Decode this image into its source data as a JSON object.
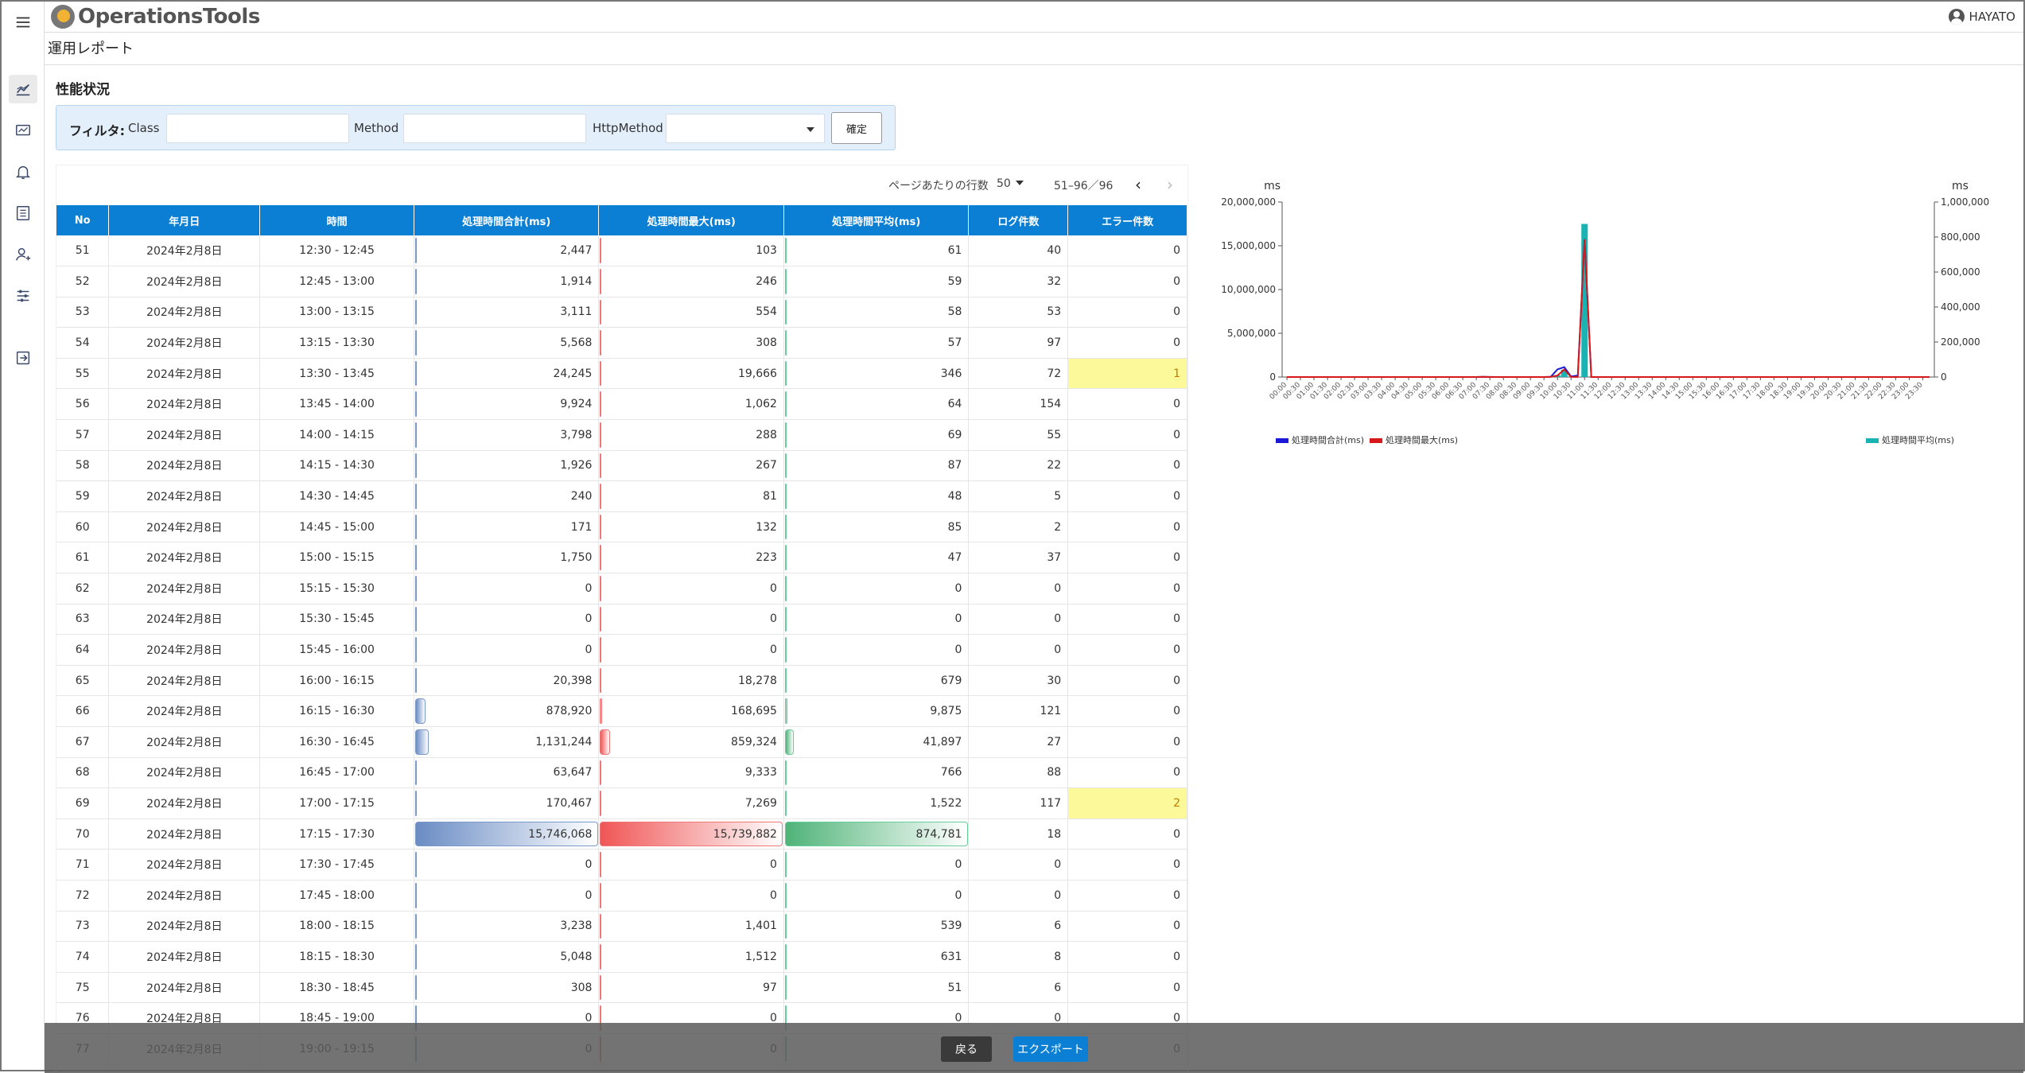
{
  "app": {
    "logo_text": "OperationsTools",
    "user_name": "HAYATO"
  },
  "page": {
    "title": "運用レポート",
    "section_title": "性能状況"
  },
  "filter": {
    "label": "フィルタ:",
    "class_label": "Class",
    "class_value": "",
    "method_label": "Method",
    "method_value": "",
    "httpmethod_label": "HttpMethod",
    "httpmethod_value": "",
    "confirm_label": "確定"
  },
  "pager": {
    "rows_label": "ページあたりの行数",
    "rows_value": "50",
    "range": "51–96／96"
  },
  "table": {
    "headers": [
      "No",
      "年月日",
      "時間",
      "処理時間合計(ms)",
      "処理時間最大(ms)",
      "処理時間平均(ms)",
      "ログ件数",
      "エラー件数"
    ],
    "bar_maxima": {
      "total": 15746068,
      "max": 15739882,
      "avg": 874781
    },
    "rows": [
      {
        "no": "51",
        "date": "2024年2月8日",
        "time": "12:30 - 12:45",
        "total": "2,447",
        "max": "103",
        "avg": "61",
        "logs": "40",
        "errors": "0"
      },
      {
        "no": "52",
        "date": "2024年2月8日",
        "time": "12:45 - 13:00",
        "total": "1,914",
        "max": "246",
        "avg": "59",
        "logs": "32",
        "errors": "0"
      },
      {
        "no": "53",
        "date": "2024年2月8日",
        "time": "13:00 - 13:15",
        "total": "3,111",
        "max": "554",
        "avg": "58",
        "logs": "53",
        "errors": "0"
      },
      {
        "no": "54",
        "date": "2024年2月8日",
        "time": "13:15 - 13:30",
        "total": "5,568",
        "max": "308",
        "avg": "57",
        "logs": "97",
        "errors": "0"
      },
      {
        "no": "55",
        "date": "2024年2月8日",
        "time": "13:30 - 13:45",
        "total": "24,245",
        "max": "19,666",
        "avg": "346",
        "logs": "72",
        "errors": "1"
      },
      {
        "no": "56",
        "date": "2024年2月8日",
        "time": "13:45 - 14:00",
        "total": "9,924",
        "max": "1,062",
        "avg": "64",
        "logs": "154",
        "errors": "0"
      },
      {
        "no": "57",
        "date": "2024年2月8日",
        "time": "14:00 - 14:15",
        "total": "3,798",
        "max": "288",
        "avg": "69",
        "logs": "55",
        "errors": "0"
      },
      {
        "no": "58",
        "date": "2024年2月8日",
        "time": "14:15 - 14:30",
        "total": "1,926",
        "max": "267",
        "avg": "87",
        "logs": "22",
        "errors": "0"
      },
      {
        "no": "59",
        "date": "2024年2月8日",
        "time": "14:30 - 14:45",
        "total": "240",
        "max": "81",
        "avg": "48",
        "logs": "5",
        "errors": "0"
      },
      {
        "no": "60",
        "date": "2024年2月8日",
        "time": "14:45 - 15:00",
        "total": "171",
        "max": "132",
        "avg": "85",
        "logs": "2",
        "errors": "0"
      },
      {
        "no": "61",
        "date": "2024年2月8日",
        "time": "15:00 - 15:15",
        "total": "1,750",
        "max": "223",
        "avg": "47",
        "logs": "37",
        "errors": "0"
      },
      {
        "no": "62",
        "date": "2024年2月8日",
        "time": "15:15 - 15:30",
        "total": "0",
        "max": "0",
        "avg": "0",
        "logs": "0",
        "errors": "0"
      },
      {
        "no": "63",
        "date": "2024年2月8日",
        "time": "15:30 - 15:45",
        "total": "0",
        "max": "0",
        "avg": "0",
        "logs": "0",
        "errors": "0"
      },
      {
        "no": "64",
        "date": "2024年2月8日",
        "time": "15:45 - 16:00",
        "total": "0",
        "max": "0",
        "avg": "0",
        "logs": "0",
        "errors": "0"
      },
      {
        "no": "65",
        "date": "2024年2月8日",
        "time": "16:00 - 16:15",
        "total": "20,398",
        "max": "18,278",
        "avg": "679",
        "logs": "30",
        "errors": "0"
      },
      {
        "no": "66",
        "date": "2024年2月8日",
        "time": "16:15 - 16:30",
        "total": "878,920",
        "max": "168,695",
        "avg": "9,875",
        "logs": "121",
        "errors": "0"
      },
      {
        "no": "67",
        "date": "2024年2月8日",
        "time": "16:30 - 16:45",
        "total": "1,131,244",
        "max": "859,324",
        "avg": "41,897",
        "logs": "27",
        "errors": "0"
      },
      {
        "no": "68",
        "date": "2024年2月8日",
        "time": "16:45 - 17:00",
        "total": "63,647",
        "max": "9,333",
        "avg": "766",
        "logs": "88",
        "errors": "0"
      },
      {
        "no": "69",
        "date": "2024年2月8日",
        "time": "17:00 - 17:15",
        "total": "170,467",
        "max": "7,269",
        "avg": "1,522",
        "logs": "117",
        "errors": "2"
      },
      {
        "no": "70",
        "date": "2024年2月8日",
        "time": "17:15 - 17:30",
        "total": "15,746,068",
        "max": "15,739,882",
        "avg": "874,781",
        "logs": "18",
        "errors": "0"
      },
      {
        "no": "71",
        "date": "2024年2月8日",
        "time": "17:30 - 17:45",
        "total": "0",
        "max": "0",
        "avg": "0",
        "logs": "0",
        "errors": "0"
      },
      {
        "no": "72",
        "date": "2024年2月8日",
        "time": "17:45 - 18:00",
        "total": "0",
        "max": "0",
        "avg": "0",
        "logs": "0",
        "errors": "0"
      },
      {
        "no": "73",
        "date": "2024年2月8日",
        "time": "18:00 - 18:15",
        "total": "3,238",
        "max": "1,401",
        "avg": "539",
        "logs": "6",
        "errors": "0"
      },
      {
        "no": "74",
        "date": "2024年2月8日",
        "time": "18:15 - 18:30",
        "total": "5,048",
        "max": "1,512",
        "avg": "631",
        "logs": "8",
        "errors": "0"
      },
      {
        "no": "75",
        "date": "2024年2月8日",
        "time": "18:30 - 18:45",
        "total": "308",
        "max": "97",
        "avg": "51",
        "logs": "6",
        "errors": "0"
      },
      {
        "no": "76",
        "date": "2024年2月8日",
        "time": "18:45 - 19:00",
        "total": "0",
        "max": "0",
        "avg": "0",
        "logs": "0",
        "errors": "0"
      },
      {
        "no": "77",
        "date": "2024年2月8日",
        "time": "19:00 - 19:15",
        "total": "0",
        "max": "0",
        "avg": "0",
        "logs": "0",
        "errors": "0"
      }
    ]
  },
  "chart_data": {
    "type": "line",
    "left_unit": "ms",
    "right_unit": "ms",
    "left_ticks": [
      "0",
      "5,000,000",
      "10,000,000",
      "15,000,000",
      "20,000,000"
    ],
    "right_ticks": [
      "0",
      "200,000",
      "400,000",
      "600,000",
      "800,000",
      "1,000,000"
    ],
    "ylim_left": [
      0,
      20000000
    ],
    "ylim_right": [
      0,
      1000000
    ],
    "x": [
      "00:00",
      "00:30",
      "01:00",
      "01:30",
      "02:00",
      "02:30",
      "03:00",
      "03:30",
      "04:00",
      "04:30",
      "05:00",
      "05:30",
      "06:00",
      "06:30",
      "07:00",
      "07:30",
      "08:00",
      "08:30",
      "09:00",
      "09:30",
      "10:00",
      "10:30",
      "11:00",
      "11:30",
      "12:00",
      "12:30",
      "13:00",
      "13:30",
      "14:00",
      "14:30",
      "15:00",
      "15:30",
      "16:00",
      "16:30",
      "17:00",
      "17:30",
      "18:00",
      "18:30",
      "19:00",
      "19:30",
      "20:00",
      "20:30",
      "21:00",
      "21:30",
      "22:00",
      "22:30",
      "23:00",
      "23:30"
    ],
    "series": [
      {
        "name": "処理時間合計(ms)",
        "axis": "left",
        "color": "#1a1ad6",
        "values": [
          0,
          0,
          0,
          0,
          0,
          0,
          0,
          0,
          0,
          0,
          0,
          0,
          0,
          0,
          0,
          0,
          0,
          0,
          0,
          0,
          0,
          0,
          0,
          0,
          0,
          2447,
          1914,
          3111,
          5568,
          24245,
          9924,
          3798,
          1926,
          240,
          171,
          1750,
          0,
          0,
          0,
          20398,
          878920,
          1131244,
          63647,
          170467,
          15746068,
          0,
          0,
          3238,
          5048,
          308,
          0,
          0,
          0,
          0,
          0,
          0,
          0,
          0,
          0,
          0,
          0,
          0,
          0,
          0,
          0,
          0,
          0,
          0,
          0,
          0,
          0,
          0,
          0,
          0,
          0,
          0,
          0,
          0,
          0,
          0,
          0,
          0,
          0,
          0,
          0,
          0,
          0,
          0,
          0,
          0,
          0,
          0,
          0,
          0,
          0,
          0
        ]
      },
      {
        "name": "処理時間最大(ms)",
        "axis": "left",
        "color": "#d81818",
        "values": [
          0,
          0,
          0,
          0,
          0,
          0,
          0,
          0,
          0,
          0,
          0,
          0,
          0,
          0,
          0,
          0,
          0,
          0,
          0,
          0,
          0,
          0,
          0,
          0,
          0,
          103,
          246,
          554,
          308,
          19666,
          1062,
          288,
          267,
          81,
          132,
          223,
          0,
          0,
          0,
          18278,
          168695,
          859324,
          9333,
          7269,
          15739882,
          0,
          0,
          1401,
          1512,
          97,
          0,
          0,
          0,
          0,
          0,
          0,
          0,
          0,
          0,
          0,
          0,
          0,
          0,
          0,
          0,
          0,
          0,
          0,
          0,
          0,
          0,
          0,
          0,
          0,
          0,
          0,
          0,
          0,
          0,
          0,
          0,
          0,
          0,
          0,
          0,
          0,
          0,
          0,
          0,
          0,
          0,
          0,
          0,
          0,
          0,
          0
        ]
      },
      {
        "name": "処理時間平均(ms)",
        "axis": "right",
        "color": "#1ab3b3",
        "type": "bar",
        "values": [
          0,
          0,
          0,
          0,
          0,
          0,
          0,
          0,
          0,
          0,
          0,
          0,
          0,
          0,
          0,
          0,
          0,
          0,
          0,
          0,
          0,
          0,
          0,
          0,
          0,
          61,
          59,
          58,
          57,
          346,
          64,
          69,
          87,
          48,
          85,
          47,
          0,
          0,
          0,
          679,
          9875,
          41897,
          766,
          1522,
          874781,
          0,
          0,
          539,
          631,
          51,
          0,
          0,
          0,
          0,
          0,
          0,
          0,
          0,
          0,
          0,
          0,
          0,
          0,
          0,
          0,
          0,
          0,
          0,
          0,
          0,
          0,
          0,
          0,
          0,
          0,
          0,
          0,
          0,
          0,
          0,
          0,
          0,
          0,
          0,
          0,
          0,
          0,
          0,
          0,
          0,
          0,
          0,
          0,
          0,
          0,
          0
        ]
      }
    ],
    "legend_placement": "bottom"
  },
  "footer": {
    "back_label": "戻る",
    "export_label": "エクスポート"
  }
}
